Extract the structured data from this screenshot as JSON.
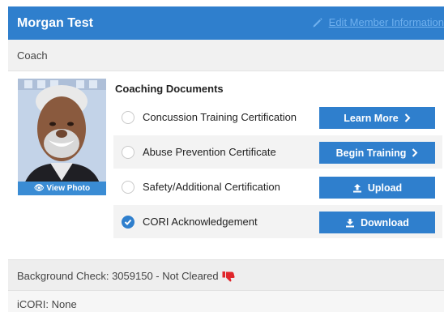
{
  "header": {
    "member_name": "Morgan Test",
    "edit_link_label": "Edit Member Information"
  },
  "role": "Coach",
  "photo": {
    "view_label": "View Photo"
  },
  "documents": {
    "title": "Coaching Documents",
    "items": [
      {
        "label": "Concussion Training Certification",
        "checked": false,
        "button_label": "Learn More",
        "button_icon": "chevron-right-icon"
      },
      {
        "label": "Abuse Prevention Certificate",
        "checked": false,
        "button_label": "Begin Training",
        "button_icon": "chevron-right-icon"
      },
      {
        "label": "Safety/Additional Certification",
        "checked": false,
        "button_label": "Upload",
        "button_icon": "upload-icon"
      },
      {
        "label": "CORI Acknowledgement",
        "checked": true,
        "button_label": "Download",
        "button_icon": "download-icon"
      }
    ]
  },
  "background_check": "Background Check: 3059150 - Not Cleared",
  "icori": "iCORI: None",
  "colors": {
    "header_bg": "#2f7fcd",
    "button_bg": "#2f7fcd",
    "status_red": "#e0262b"
  }
}
